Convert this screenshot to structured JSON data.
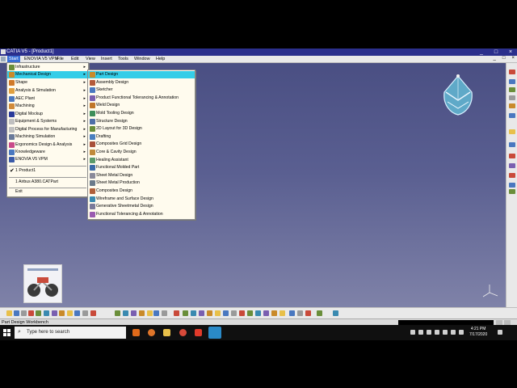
{
  "window": {
    "title": "CATIA V5 - [Product1]",
    "controls": [
      "_",
      "□",
      "×"
    ]
  },
  "menubar": {
    "items": [
      "Start",
      "ENOVIA V5 VPM",
      "File",
      "Edit",
      "View",
      "Insert",
      "Tools",
      "Window",
      "Help"
    ],
    "active": "Start",
    "doc_controls": [
      "_",
      "□",
      "×"
    ]
  },
  "start_menu": {
    "items": [
      {
        "label": "Infrastructure",
        "submenu": true
      },
      {
        "label": "Mechanical Design",
        "submenu": true,
        "highlighted": true
      },
      {
        "label": "Shape",
        "submenu": true
      },
      {
        "label": "Analysis & Simulation",
        "submenu": true
      },
      {
        "label": "AEC Plant",
        "submenu": true
      },
      {
        "label": "Machining",
        "submenu": true
      },
      {
        "label": "Digital Mockup",
        "submenu": true
      },
      {
        "label": "Equipment & Systems",
        "submenu": true
      },
      {
        "label": "Digital Process for Manufacturing",
        "submenu": true
      },
      {
        "label": "Machining Simulation",
        "submenu": true
      },
      {
        "label": "Ergonomics Design & Analysis",
        "submenu": true
      },
      {
        "label": "Knowledgeware",
        "submenu": true
      },
      {
        "label": "ENOVIA V5 VPM",
        "submenu": true
      }
    ],
    "windows": [
      {
        "label": "1 Product1",
        "checked": true
      }
    ],
    "recent": [
      {
        "label": "1 Airbus A380.CATPart"
      }
    ],
    "exit_label": "Exit"
  },
  "submenu": {
    "items": [
      {
        "label": "Part Design",
        "highlighted": true,
        "color": "#c98a2a"
      },
      {
        "label": "Assembly Design",
        "color": "#b45a3a"
      },
      {
        "label": "Sketcher",
        "color": "#4a78c0"
      },
      {
        "label": "Product Functional Tolerancing & Annotation",
        "color": "#7a5fb0"
      },
      {
        "label": "Weld Design",
        "color": "#c0762a"
      },
      {
        "label": "Mold Tooling Design",
        "color": "#3d8e5a"
      },
      {
        "label": "Structure Design",
        "color": "#4f6fa8"
      },
      {
        "label": "2D Layout for 3D Design",
        "color": "#6a8e3a"
      },
      {
        "label": "Drafting",
        "color": "#4a7fbf"
      },
      {
        "label": "Composites Grid Design",
        "color": "#a8503a"
      },
      {
        "label": "Core & Cavity Design",
        "color": "#c08a3a"
      },
      {
        "label": "Healing Assistant",
        "color": "#5a9a6a"
      },
      {
        "label": "Functional Molded Part",
        "color": "#3a6aa8"
      },
      {
        "label": "Sheet Metal Design",
        "color": "#8a8a9a"
      },
      {
        "label": "Sheet Metal Production",
        "color": "#6a7a8a"
      },
      {
        "label": "Composites Design",
        "color": "#b0603a"
      },
      {
        "label": "Wireframe and Surface Design",
        "color": "#3a8ab0"
      },
      {
        "label": "Generative Sheetmetal Design",
        "color": "#7a7a9a"
      },
      {
        "label": "Functional Tolerancing & Annotation",
        "color": "#9a5ab0"
      }
    ]
  },
  "status_bar": {
    "text": "Part Design Workbench"
  },
  "taskbar": {
    "search_placeholder": "Type here to search",
    "time": "4:21 PM",
    "date": "7/17/2020"
  },
  "colors": {
    "titlebar": "#2b2f8c",
    "highlight": "#34cde8",
    "menu_bg": "#fffbee",
    "workspace_top": "#4a4f83",
    "workspace_bottom": "#7f82a8"
  }
}
